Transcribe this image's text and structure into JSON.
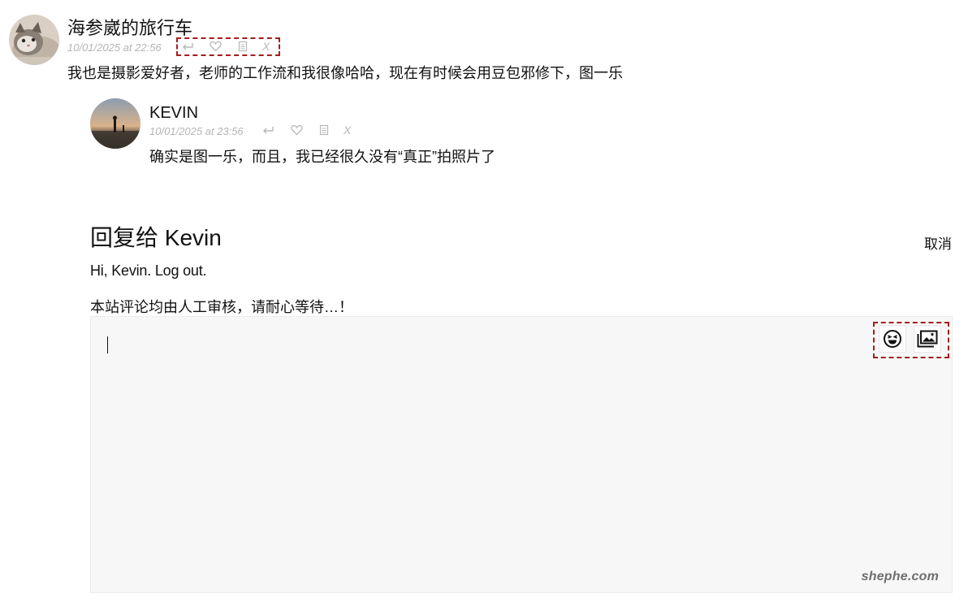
{
  "comment": {
    "author": "海参崴的旅行车",
    "date": "10/01/2025 at 22:56",
    "text": "我也是摄影爱好者，老师的工作流和我很像哈哈，现在有时候会用豆包邪修下，图一乐",
    "actions": {
      "reply_icon": "reply-icon",
      "like_icon": "heart-icon",
      "copy_icon": "document-icon",
      "delete_label": "X"
    }
  },
  "reply": {
    "author": "KEVIN",
    "date": "10/01/2025 at 23:56",
    "text": "确实是图一乐，而且，我已经很久没有“真正”拍照片了",
    "actions": {
      "reply_icon": "reply-icon",
      "like_icon": "heart-icon",
      "copy_icon": "document-icon",
      "delete_label": "X"
    }
  },
  "reply_form": {
    "title": "回复给 Kevin",
    "cancel_label": "取消",
    "logged_in_prefix": "Hi, Kevin. ",
    "logout_label": "Log out.",
    "notice": "本站评论均由人工审核，请耐心等待…！",
    "textarea_value": "",
    "emoji_icon": "laughing-emoji-icon",
    "image_icon": "image-icon"
  },
  "watermark": "shephe.com",
  "colors": {
    "highlight_border": "#a51d1d",
    "meta_gray": "#b5b5b5",
    "textarea_bg": "#f7f7f7"
  }
}
